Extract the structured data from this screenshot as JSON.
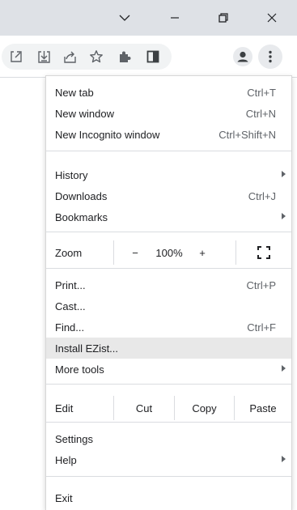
{
  "window_controls": {
    "dropdown": "chevron-down-icon",
    "minimize": "minimize-icon",
    "restore": "restore-icon",
    "close": "close-icon"
  },
  "toolbar": {
    "icons": [
      "open-in-new-window-icon",
      "install-app-icon",
      "share-icon",
      "bookmark-star-icon",
      "extensions-icon",
      "side-panel-icon",
      "profile-avatar-icon",
      "more-menu-icon"
    ]
  },
  "menu": {
    "new_tab": {
      "label": "New tab",
      "shortcut": "Ctrl+T"
    },
    "new_window": {
      "label": "New window",
      "shortcut": "Ctrl+N"
    },
    "new_incognito": {
      "label": "New Incognito window",
      "shortcut": "Ctrl+Shift+N"
    },
    "history": {
      "label": "History"
    },
    "downloads": {
      "label": "Downloads",
      "shortcut": "Ctrl+J"
    },
    "bookmarks": {
      "label": "Bookmarks"
    },
    "zoom": {
      "label": "Zoom",
      "minus": "−",
      "level": "100%",
      "plus": "+"
    },
    "print": {
      "label": "Print...",
      "shortcut": "Ctrl+P"
    },
    "cast": {
      "label": "Cast..."
    },
    "find": {
      "label": "Find...",
      "shortcut": "Ctrl+F"
    },
    "install": {
      "label": "Install EZist..."
    },
    "more_tools": {
      "label": "More tools"
    },
    "edit": {
      "label": "Edit",
      "cut": "Cut",
      "copy": "Copy",
      "paste": "Paste"
    },
    "settings": {
      "label": "Settings"
    },
    "help": {
      "label": "Help"
    },
    "exit": {
      "label": "Exit"
    }
  }
}
